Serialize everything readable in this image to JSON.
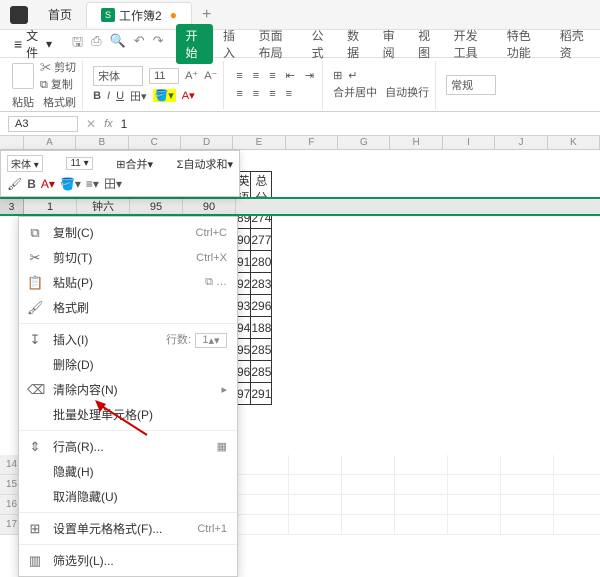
{
  "titlebar": {
    "home_tab": "首页",
    "doc_tab": "工作簿2",
    "add": "+"
  },
  "ribbon": {
    "file": "文件",
    "tabs": [
      "开始",
      "插入",
      "页面布局",
      "公式",
      "数据",
      "审阅",
      "视图",
      "开发工具",
      "特色功能",
      "稻壳资"
    ],
    "active_index": 0
  },
  "toolbar": {
    "paste": "粘贴",
    "cut": "剪切",
    "copy": "复制",
    "format_painter": "格式刷",
    "font_name": "宋体",
    "font_size": "11",
    "merge": "合并居中",
    "wrap": "自动换行",
    "number_format": "常规"
  },
  "formula_bar": {
    "name_box": "A3",
    "fx": "fx",
    "value": "1"
  },
  "columns": [
    "A",
    "B",
    "C",
    "D",
    "E",
    "F",
    "G",
    "H",
    "I",
    "J",
    "K"
  ],
  "data_headers": {
    "e": "英语",
    "f": "总分"
  },
  "data_rows": [
    {
      "e": "89",
      "f": "274"
    },
    {
      "e": "90",
      "f": "277"
    },
    {
      "e": "91",
      "f": "280"
    },
    {
      "e": "92",
      "f": "283"
    },
    {
      "e": "93",
      "f": "296"
    },
    {
      "e": "94",
      "f": "188"
    },
    {
      "e": "95",
      "f": "285"
    },
    {
      "e": "96",
      "f": "285"
    },
    {
      "e": "97",
      "f": "291"
    }
  ],
  "mini_toolbar": {
    "font": "宋体",
    "size": "11",
    "merge": "合并",
    "autosum": "自动求和"
  },
  "selected_row": {
    "num": "3",
    "a": "1",
    "b": "钟六",
    "c": "95",
    "d": "90"
  },
  "context_menu": {
    "copy": "复制(C)",
    "copy_sc": "Ctrl+C",
    "cut": "剪切(T)",
    "cut_sc": "Ctrl+X",
    "paste": "粘贴(P)",
    "format_painter": "格式刷",
    "insert": "插入(I)",
    "insert_rows_label": "行数:",
    "insert_rows_value": "1",
    "delete": "删除(D)",
    "clear": "清除内容(N)",
    "batch": "批量处理单元格(P)",
    "row_height": "行高(R)...",
    "hide": "隐藏(H)",
    "unhide": "取消隐藏(U)",
    "format_cells": "设置单元格格式(F)...",
    "format_cells_sc": "Ctrl+1",
    "filter": "筛选列(L)..."
  },
  "left_row_nums": [
    "14",
    "15",
    "16",
    "17"
  ]
}
